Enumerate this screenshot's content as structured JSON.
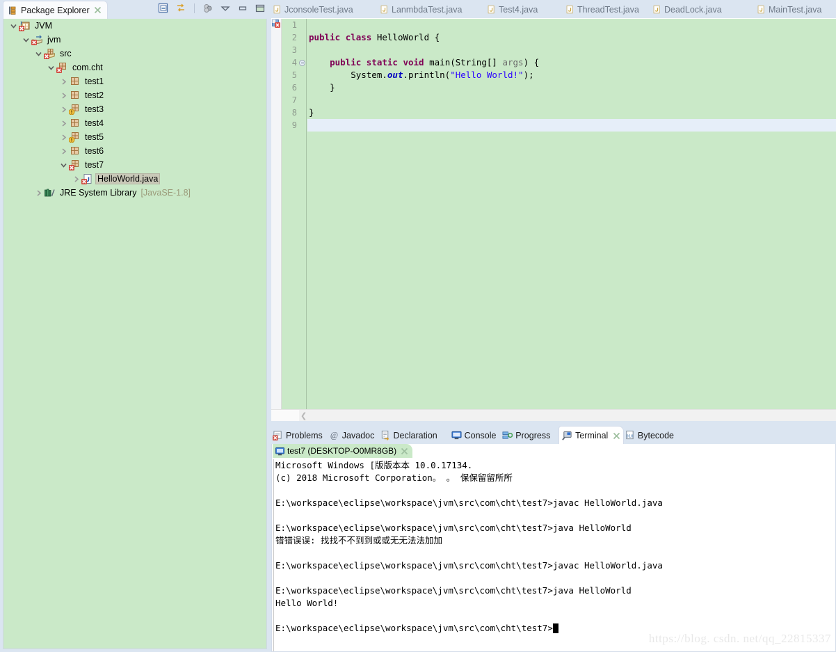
{
  "explorer": {
    "title": "Package Explorer",
    "close_label": "╳",
    "toolbar": [
      {
        "name": "collapse-all-icon",
        "tooltip": "Collapse All"
      },
      {
        "name": "link-with-editor-icon",
        "tooltip": "Link with Editor"
      },
      {
        "name": "view-menu-icon",
        "tooltip": "View Menu"
      },
      {
        "name": "minimize-icon",
        "tooltip": "Minimize"
      },
      {
        "name": "maximize-icon",
        "tooltip": "Maximize"
      }
    ],
    "tree": [
      {
        "label": "JVM",
        "suffix": "",
        "depth": 0,
        "expander": "down",
        "icon": "java-project-error-icon",
        "selected": false
      },
      {
        "label": "jvm",
        "suffix": "",
        "depth": 1,
        "expander": "down",
        "icon": "source-folder-error-icon",
        "selected": false
      },
      {
        "label": "src",
        "suffix": "",
        "depth": 2,
        "expander": "down",
        "icon": "package-root-error-icon",
        "selected": false
      },
      {
        "label": "com.cht",
        "suffix": "",
        "depth": 3,
        "expander": "down",
        "icon": "package-error-icon",
        "selected": false
      },
      {
        "label": "test1",
        "suffix": "",
        "depth": 4,
        "expander": "right",
        "icon": "package-icon",
        "selected": false
      },
      {
        "label": "test2",
        "suffix": "",
        "depth": 4,
        "expander": "right",
        "icon": "package-icon",
        "selected": false
      },
      {
        "label": "test3",
        "suffix": "",
        "depth": 4,
        "expander": "right",
        "icon": "package-warning-icon",
        "selected": false
      },
      {
        "label": "test4",
        "suffix": "",
        "depth": 4,
        "expander": "right",
        "icon": "package-icon",
        "selected": false
      },
      {
        "label": "test5",
        "suffix": "",
        "depth": 4,
        "expander": "right",
        "icon": "package-warning-icon",
        "selected": false
      },
      {
        "label": "test6",
        "suffix": "",
        "depth": 4,
        "expander": "right",
        "icon": "package-icon",
        "selected": false
      },
      {
        "label": "test7",
        "suffix": "",
        "depth": 4,
        "expander": "down",
        "icon": "package-error-icon",
        "selected": false
      },
      {
        "label": "HelloWorld.java",
        "suffix": "",
        "depth": 5,
        "expander": "right",
        "icon": "java-file-error-icon",
        "selected": true
      },
      {
        "label": "JRE System Library",
        "suffix": "[JavaSE-1.8]",
        "depth": 2,
        "expander": "right",
        "icon": "library-icon",
        "selected": false
      }
    ]
  },
  "editor": {
    "tabs": [
      {
        "label": "JconsoleTest.java",
        "active": false
      },
      {
        "label": "LanmbdaTest.java",
        "active": false
      },
      {
        "label": "Test4.java",
        "active": false
      },
      {
        "label": "ThreadTest.java",
        "active": false
      },
      {
        "label": "DeadLock.java",
        "active": false
      },
      {
        "label": "MainTest.java",
        "active": false
      }
    ],
    "line_numbers": [
      "1",
      "2",
      "3",
      "4",
      "5",
      "6",
      "7",
      "8",
      "9"
    ],
    "current_line": 9,
    "fold_marker_line": 4,
    "marker_icon": "error-marker-icon",
    "code": [
      {
        "line": 1,
        "tokens": []
      },
      {
        "line": 2,
        "tokens": [
          {
            "t": "public",
            "c": "kw"
          },
          {
            "t": " ",
            "c": ""
          },
          {
            "t": "class",
            "c": "kw"
          },
          {
            "t": " HelloWorld {",
            "c": "cls"
          }
        ]
      },
      {
        "line": 3,
        "tokens": []
      },
      {
        "line": 4,
        "tokens": [
          {
            "t": "    ",
            "c": ""
          },
          {
            "t": "public",
            "c": "kw"
          },
          {
            "t": " ",
            "c": ""
          },
          {
            "t": "static",
            "c": "kw"
          },
          {
            "t": " ",
            "c": ""
          },
          {
            "t": "void",
            "c": "kw"
          },
          {
            "t": " main(String[] ",
            "c": "cls"
          },
          {
            "t": "args",
            "c": "par"
          },
          {
            "t": ") {",
            "c": "cls"
          }
        ]
      },
      {
        "line": 5,
        "tokens": [
          {
            "t": "        System.",
            "c": "cls"
          },
          {
            "t": "out",
            "c": "fld"
          },
          {
            "t": ".println(",
            "c": "cls"
          },
          {
            "t": "\"Hello World!\"",
            "c": "str"
          },
          {
            "t": ");",
            "c": "cls"
          }
        ]
      },
      {
        "line": 6,
        "tokens": [
          {
            "t": "    }",
            "c": "cls"
          }
        ]
      },
      {
        "line": 7,
        "tokens": []
      },
      {
        "line": 8,
        "tokens": [
          {
            "t": "}",
            "c": "cls"
          }
        ]
      },
      {
        "line": 9,
        "tokens": []
      }
    ],
    "hscroll_left_icon": "scroll-left-icon"
  },
  "bottom_panel": {
    "tabs": [
      {
        "label": "Problems",
        "icon": "problems-icon",
        "active": false,
        "closable": false
      },
      {
        "label": "Javadoc",
        "icon": "javadoc-icon",
        "active": false,
        "closable": false
      },
      {
        "label": "Declaration",
        "icon": "declaration-icon",
        "active": false,
        "closable": false
      },
      {
        "label": "Console",
        "icon": "console-icon",
        "active": false,
        "closable": false
      },
      {
        "label": "Progress",
        "icon": "progress-icon",
        "active": false,
        "closable": false
      },
      {
        "label": "Terminal",
        "icon": "terminal-icon",
        "active": true,
        "closable": true
      },
      {
        "label": "Bytecode",
        "icon": "bytecode-icon",
        "active": false,
        "closable": false
      }
    ],
    "close_label": "╳",
    "terminal_subtab": {
      "label": "test7 (DESKTOP-O0MR8GB)",
      "icon": "terminal-session-icon",
      "close_label": "╳"
    },
    "terminal_lines": [
      "Microsoft Windows [版版本本 10.0.17134.",
      "(c) 2018 Microsoft Corporation。 。 保保留留所所",
      "",
      "E:\\workspace\\eclipse\\workspace\\jvm\\src\\com\\cht\\test7>javac HelloWorld.java",
      "",
      "E:\\workspace\\eclipse\\workspace\\jvm\\src\\com\\cht\\test7>java HelloWorld",
      "错错误误: 找找不不到到或或无无法法加加",
      "",
      "E:\\workspace\\eclipse\\workspace\\jvm\\src\\com\\cht\\test7>javac HelloWorld.java",
      "",
      "E:\\workspace\\eclipse\\workspace\\jvm\\src\\com\\cht\\test7>java HelloWorld",
      "Hello World!",
      "",
      "E:\\workspace\\eclipse\\workspace\\jvm\\src\\com\\cht\\test7>"
    ],
    "prompt_line_index": 13
  },
  "watermark": "https://blog. csdn. net/qq_22815337",
  "colors": {
    "chrome": "#dbe5f1",
    "editor_bg": "#cae9c8",
    "tree_bg": "#cae9c8",
    "terminal_bg": "#ffffff",
    "current_line": "#e6eef9",
    "keyword": "#7f0055",
    "string": "#2a00ff",
    "field": "#0000c0",
    "selection": "#c9c9b8",
    "library_suffix": "#9b9b7a"
  }
}
